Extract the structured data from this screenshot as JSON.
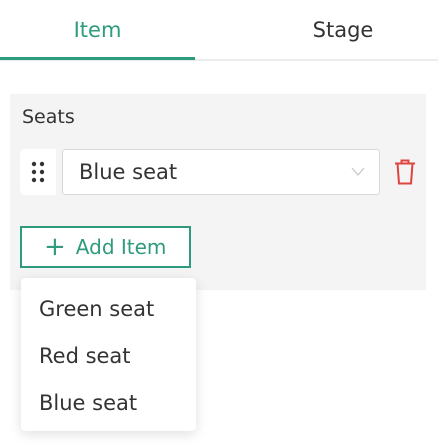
{
  "tabs": [
    {
      "label": "Item",
      "active": true
    },
    {
      "label": "Stage",
      "active": false
    }
  ],
  "panel": {
    "label": "Seats",
    "seat_select": {
      "value": "Blue seat"
    },
    "add_item_label": "Add Item"
  },
  "dropdown": {
    "options": [
      "Green seat",
      "Red seat",
      "Blue seat"
    ]
  },
  "colors": {
    "accent": "#2e9b7e",
    "danger": "#e0443e",
    "panel_bg": "#f4f4f4",
    "text": "#333333"
  },
  "icons": [
    "drag-handle-icon",
    "chevron-down-icon",
    "trash-icon",
    "plus-icon"
  ]
}
